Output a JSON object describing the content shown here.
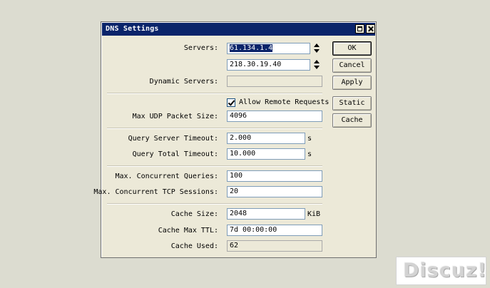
{
  "window": {
    "title": "DNS Settings"
  },
  "labels": {
    "servers": "Servers:",
    "dynamic_servers": "Dynamic Servers:",
    "max_udp_packet_size": "Max UDP Packet Size:",
    "query_server_timeout": "Query Server Timeout:",
    "query_total_timeout": "Query Total Timeout:",
    "max_concurrent_queries": "Max. Concurrent Queries:",
    "max_concurrent_tcp_sessions": "Max. Concurrent TCP Sessions:",
    "cache_size": "Cache Size:",
    "cache_max_ttl": "Cache Max TTL:",
    "cache_used": "Cache Used:"
  },
  "values": {
    "server_1": "61.134.1.4",
    "server_2": "218.30.19.40",
    "dynamic_servers": "",
    "allow_remote_requests_label": "Allow Remote Requests",
    "allow_remote_requests_checked": true,
    "max_udp_packet_size": "4096",
    "query_server_timeout": "2.000",
    "query_total_timeout": "10.000",
    "max_concurrent_queries": "100",
    "max_concurrent_tcp_sessions": "20",
    "cache_size": "2048",
    "cache_max_ttl": "7d 00:00:00",
    "cache_used": "62"
  },
  "units": {
    "seconds": "s",
    "kib": "KiB"
  },
  "buttons": {
    "ok": "OK",
    "cancel": "Cancel",
    "apply": "Apply",
    "static": "Static",
    "cache": "Cache"
  },
  "watermark": {
    "text": "Discuz!"
  },
  "colors": {
    "titlebar": "#0a246a",
    "dialog_bg": "#ece9d8",
    "desktop_bg": "#dcdcd0"
  }
}
